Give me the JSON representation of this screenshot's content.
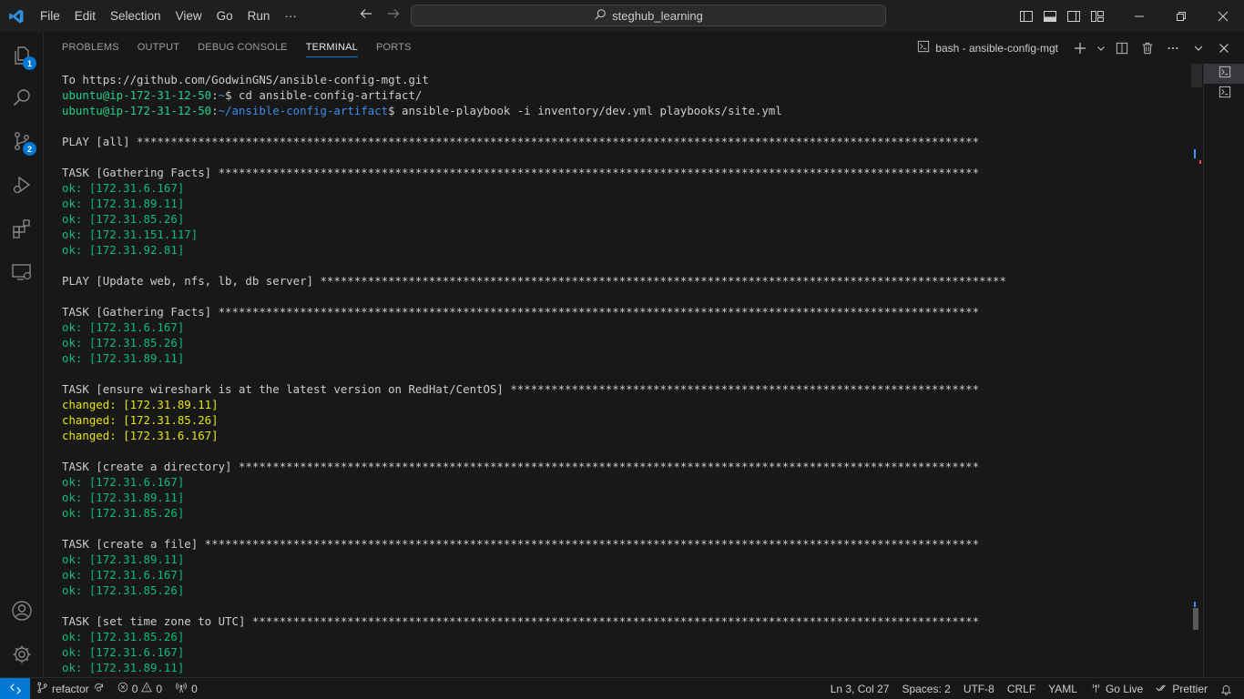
{
  "titlebar": {
    "menu": [
      "File",
      "Edit",
      "Selection",
      "View",
      "Go",
      "Run",
      "···"
    ],
    "search_text": "steghub_learning"
  },
  "activity": {
    "explorer_badge": "1",
    "scm_badge": "2"
  },
  "panel": {
    "tabs": [
      "PROBLEMS",
      "OUTPUT",
      "DEBUG CONSOLE",
      "TERMINAL",
      "PORTS"
    ],
    "active_tab": "TERMINAL",
    "terminal_name": "bash - ansible-config-mgt"
  },
  "terminal": {
    "lines": [
      [
        {
          "t": "To https://github.com/GodwinGNS/ansible-config-mgt.git",
          "c": "white"
        }
      ],
      [
        {
          "t": "ubuntu@ip-172-31-12-50",
          "c": "green"
        },
        {
          "t": ":",
          "c": "white"
        },
        {
          "t": "~",
          "c": "blue"
        },
        {
          "t": "$ cd ansible-config-artifact/",
          "c": "white"
        }
      ],
      [
        {
          "t": "ubuntu@ip-172-31-12-50",
          "c": "green"
        },
        {
          "t": ":",
          "c": "white"
        },
        {
          "t": "~/ansible-config-artifact",
          "c": "blue"
        },
        {
          "t": "$ ansible-playbook -i inventory/dev.yml playbooks/site.yml",
          "c": "white"
        }
      ],
      [],
      [
        {
          "t": "PLAY [all] ****************************************************************************************************************************",
          "c": "white"
        }
      ],
      [],
      [
        {
          "t": "TASK [Gathering Facts] ****************************************************************************************************************",
          "c": "white"
        }
      ],
      [
        {
          "t": "ok: [172.31.6.167]",
          "c": "ok"
        }
      ],
      [
        {
          "t": "ok: [172.31.89.11]",
          "c": "ok"
        }
      ],
      [
        {
          "t": "ok: [172.31.85.26]",
          "c": "ok"
        }
      ],
      [
        {
          "t": "ok: [172.31.151.117]",
          "c": "ok"
        }
      ],
      [
        {
          "t": "ok: [172.31.92.81]",
          "c": "ok"
        }
      ],
      [],
      [
        {
          "t": "PLAY [Update web, nfs, lb, db server] *****************************************************************************************************",
          "c": "white"
        }
      ],
      [],
      [
        {
          "t": "TASK [Gathering Facts] ****************************************************************************************************************",
          "c": "white"
        }
      ],
      [
        {
          "t": "ok: [172.31.6.167]",
          "c": "ok"
        }
      ],
      [
        {
          "t": "ok: [172.31.85.26]",
          "c": "ok"
        }
      ],
      [
        {
          "t": "ok: [172.31.89.11]",
          "c": "ok"
        }
      ],
      [],
      [
        {
          "t": "TASK [ensure wireshark is at the latest version on RedHat/CentOS] *********************************************************************",
          "c": "white"
        }
      ],
      [
        {
          "t": "changed: [172.31.89.11]",
          "c": "yellow"
        }
      ],
      [
        {
          "t": "changed: [172.31.85.26]",
          "c": "yellow"
        }
      ],
      [
        {
          "t": "changed: [172.31.6.167]",
          "c": "yellow"
        }
      ],
      [],
      [
        {
          "t": "TASK [create a directory] *************************************************************************************************************",
          "c": "white"
        }
      ],
      [
        {
          "t": "ok: [172.31.6.167]",
          "c": "ok"
        }
      ],
      [
        {
          "t": "ok: [172.31.89.11]",
          "c": "ok"
        }
      ],
      [
        {
          "t": "ok: [172.31.85.26]",
          "c": "ok"
        }
      ],
      [],
      [
        {
          "t": "TASK [create a file] ******************************************************************************************************************",
          "c": "white"
        }
      ],
      [
        {
          "t": "ok: [172.31.89.11]",
          "c": "ok"
        }
      ],
      [
        {
          "t": "ok: [172.31.6.167]",
          "c": "ok"
        }
      ],
      [
        {
          "t": "ok: [172.31.85.26]",
          "c": "ok"
        }
      ],
      [],
      [
        {
          "t": "TASK [set time zone to UTC] ***********************************************************************************************************",
          "c": "white"
        }
      ],
      [
        {
          "t": "ok: [172.31.85.26]",
          "c": "ok"
        }
      ],
      [
        {
          "t": "ok: [172.31.6.167]",
          "c": "ok"
        }
      ],
      [
        {
          "t": "ok: [172.31.89.11]",
          "c": "ok"
        }
      ]
    ]
  },
  "statusbar": {
    "branch": "refactor",
    "errors": "0",
    "warnings": "0",
    "ports": "0",
    "position": "Ln 3, Col 27",
    "spaces": "Spaces: 2",
    "encoding": "UTF-8",
    "eol": "CRLF",
    "language": "YAML",
    "golive": "Go Live",
    "prettier": "Prettier"
  },
  "colors": {
    "accent": "#0078d4",
    "prompt_green": "#23d18b",
    "ok_green": "#0dbc79",
    "changed_yellow": "#e5e510",
    "path_blue": "#3b8eea"
  }
}
